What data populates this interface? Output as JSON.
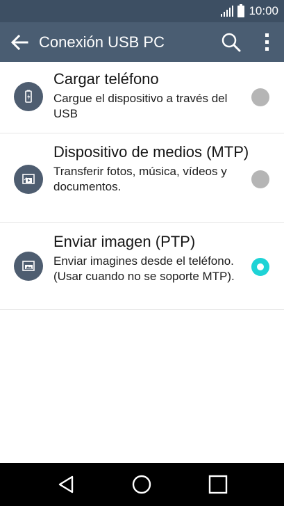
{
  "status_bar": {
    "time": "10:00",
    "icons": [
      "signal-icon",
      "battery-icon"
    ]
  },
  "app_bar": {
    "title": "Conexión USB PC",
    "icons": [
      "back-arrow-icon",
      "search-icon",
      "more-vert-icon"
    ]
  },
  "options": [
    {
      "title": "Cargar teléfono",
      "description": "Cargue el dispositivo a través del USB",
      "icon": "battery-charge-icon",
      "selected": false
    },
    {
      "title": "Dispositivo de medios (MTP)",
      "description": "Transferir fotos, música, vídeos y documentos.",
      "icon": "media-device-icon",
      "selected": false
    },
    {
      "title": "Enviar imagen (PTP)",
      "description": "Enviar imagines desde el teléfono. (Usar cuando no se soporte MTP).",
      "icon": "picture-icon",
      "selected": true
    }
  ],
  "colors": {
    "status_bar": "#3d4f63",
    "app_bar": "#4a5d72",
    "accent": "#1ed3d6",
    "radio_off": "#b5b5b5"
  },
  "nav_bar": {
    "icons": [
      "back-triangle-icon",
      "home-circle-icon",
      "recents-square-icon"
    ]
  }
}
